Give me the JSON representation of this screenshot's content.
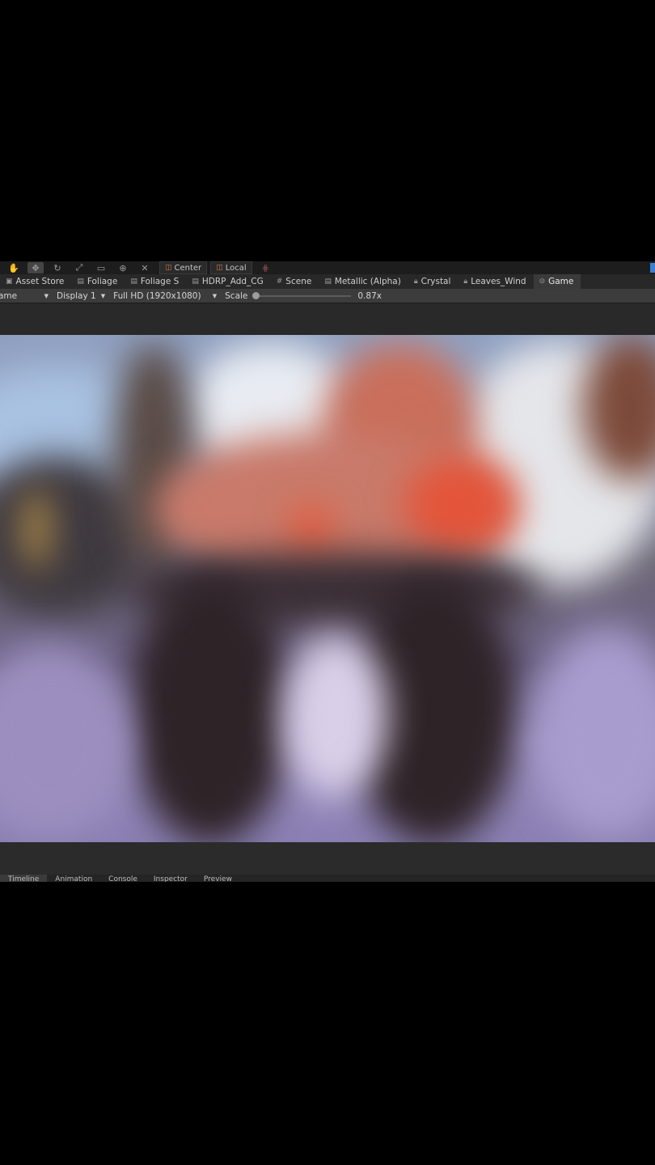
{
  "toolbar": {
    "pivot_label": "Center",
    "space_label": "Local"
  },
  "tabs": [
    {
      "label": "Asset Store",
      "icon": "store-icon"
    },
    {
      "label": "Foliage",
      "icon": "scene-icon"
    },
    {
      "label": "Foliage S",
      "icon": "scene-icon"
    },
    {
      "label": "HDRP_Add_CG",
      "icon": "scene-icon"
    },
    {
      "label": "Scene",
      "icon": "hash-icon"
    },
    {
      "label": "Metallic (Alpha)",
      "icon": "scene-icon"
    },
    {
      "label": "Crystal",
      "icon": "lock-icon"
    },
    {
      "label": "Leaves_Wind",
      "icon": "lock-icon"
    },
    {
      "label": "Game",
      "icon": "gamepad-icon",
      "active": true
    }
  ],
  "game_bar": {
    "view_mode": "ame",
    "display": "Display 1",
    "resolution": "Full HD (1920x1080)",
    "scale_label": "Scale",
    "scale_value": "0.87x"
  },
  "bottom_tabs": [
    {
      "label": "Timeline"
    },
    {
      "label": "Animation"
    },
    {
      "label": "Console"
    },
    {
      "label": "Inspector"
    },
    {
      "label": "Preview"
    }
  ],
  "colors": {
    "accent": "#3b80d6",
    "tab_active": "#3a3a3a",
    "panel": "#282828"
  }
}
